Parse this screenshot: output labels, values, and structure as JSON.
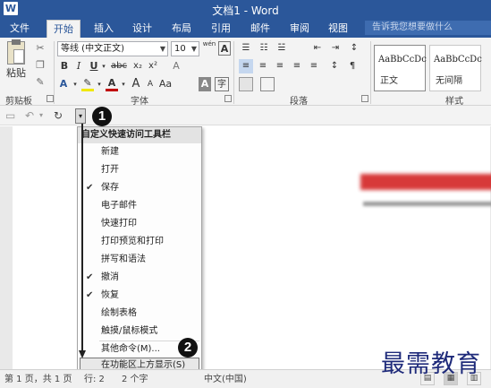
{
  "window": {
    "title": "文档1 - Word",
    "app_icon": "W"
  },
  "tabs": [
    "文件",
    "开始",
    "插入",
    "设计",
    "布局",
    "引用",
    "邮件",
    "审阅",
    "视图"
  ],
  "active_tab": "开始",
  "tell_me_placeholder": "告诉我您想要做什么",
  "ribbon": {
    "clipboard": {
      "paste_label": "粘贴",
      "group_label": "剪贴板"
    },
    "font": {
      "font_name": "等线 (中文正文)",
      "font_size": "10",
      "wen": "wén",
      "a_label": "A",
      "bold": "B",
      "italic": "I",
      "underline": "U",
      "strike": "abc",
      "sub": "x₂",
      "sup": "x²",
      "group_label": "字体"
    },
    "paragraph": {
      "group_label": "段落"
    },
    "styles": {
      "items": [
        {
          "sample": "AaBbCcDc",
          "name": "正文"
        },
        {
          "sample": "AaBbCcDc",
          "name": "无间隔"
        }
      ],
      "group_label": "样式"
    }
  },
  "qat": {
    "save_icon": "save-icon",
    "undo_icon": "undo-icon",
    "redo_icon": "repeat-icon",
    "customize_glyph": "▾"
  },
  "badges": [
    "1",
    "2"
  ],
  "menu": {
    "header": "自定义快速访问工具栏",
    "items": [
      {
        "label": "新建",
        "checked": false
      },
      {
        "label": "打开",
        "checked": false
      },
      {
        "label": "保存",
        "checked": true
      },
      {
        "label": "电子邮件",
        "checked": false
      },
      {
        "label": "快速打印",
        "checked": false
      },
      {
        "label": "打印预览和打印",
        "checked": false
      },
      {
        "label": "拼写和语法",
        "checked": false
      },
      {
        "label": "撤消",
        "checked": true
      },
      {
        "label": "恢复",
        "checked": true
      },
      {
        "label": "绘制表格",
        "checked": false
      },
      {
        "label": "触摸/鼠标模式",
        "checked": false
      }
    ],
    "more_commands": "其他命令(M)...",
    "show_below": "在功能区上方显示(S)"
  },
  "status": {
    "page": "第 1 页，共 1 页",
    "words": "行: 2",
    "chars": "2 个字",
    "lang": "中文(中国)"
  },
  "watermark": "最需教育",
  "colors": {
    "accent": "#2b579a",
    "blurred_heading": "#d32424"
  }
}
